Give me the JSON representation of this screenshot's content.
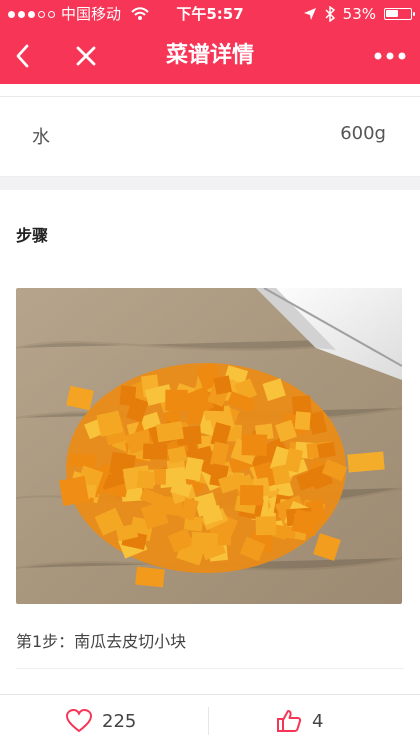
{
  "status_bar": {
    "carrier": "中国移动",
    "time": "下午5:57",
    "battery": "53%",
    "battery_level": 0.53
  },
  "nav": {
    "title": "菜谱详情"
  },
  "ingredient": {
    "name": "水",
    "amount": "600g"
  },
  "steps": {
    "title": "步骤",
    "items": [
      {
        "text": "第1步：南瓜去皮切小块"
      }
    ]
  },
  "actions": {
    "favorites_count": "225",
    "likes_count": "4"
  },
  "colors": {
    "brand": "#f73556",
    "text": "#333333",
    "muted": "#555555"
  },
  "icons": {
    "back": "back-arrow-icon",
    "close": "close-icon",
    "more": "more-dots-icon",
    "heart": "heart-icon",
    "thumb": "thumb-up-icon"
  }
}
